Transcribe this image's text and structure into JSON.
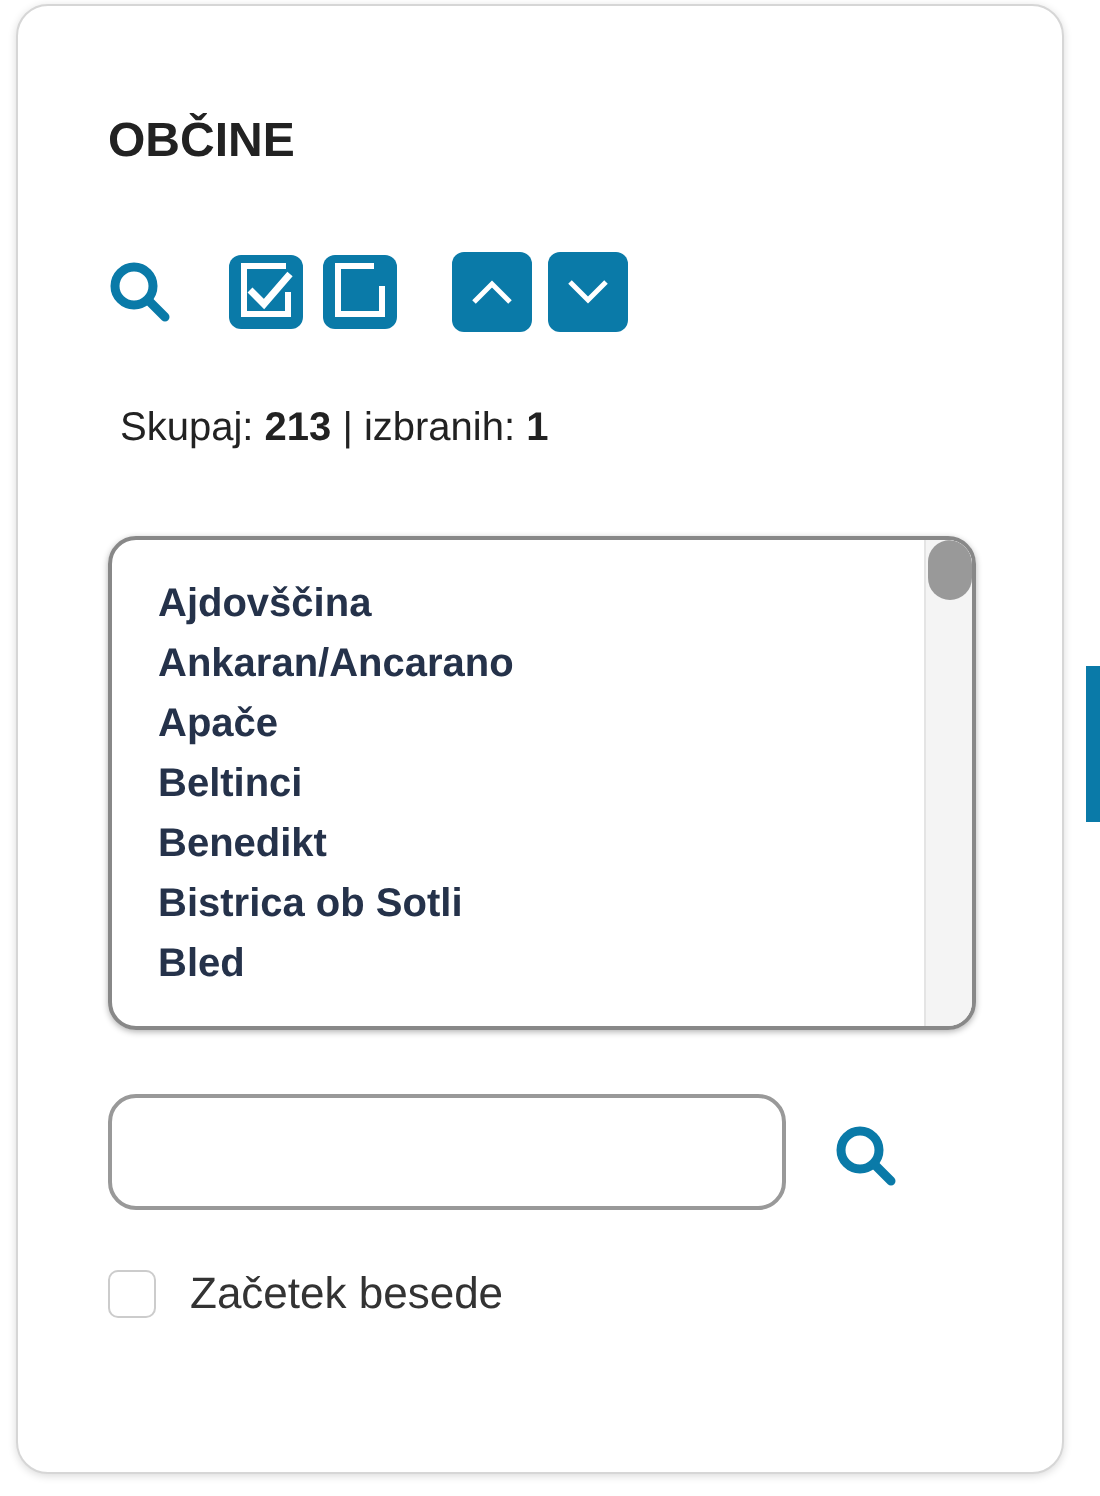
{
  "title": "OBČINE",
  "summary": "Skupaj: **213** | izbranih: **1**",
  "list": {
    "items": [
      {
        "label": "Ajdovščina",
        "selected": false
      },
      {
        "label": "Ankaran/Ancarano",
        "selected": false
      },
      {
        "label": "Apače",
        "selected": false
      },
      {
        "label": "Beltinci",
        "selected": false
      },
      {
        "label": "Benedikt",
        "selected": false
      },
      {
        "label": "Bistrica ob Sotli",
        "selected": false
      },
      {
        "label": "Bled",
        "selected": false
      }
    ]
  },
  "word_start": {
    "label": "Začetek besede",
    "checked": false
  }
}
